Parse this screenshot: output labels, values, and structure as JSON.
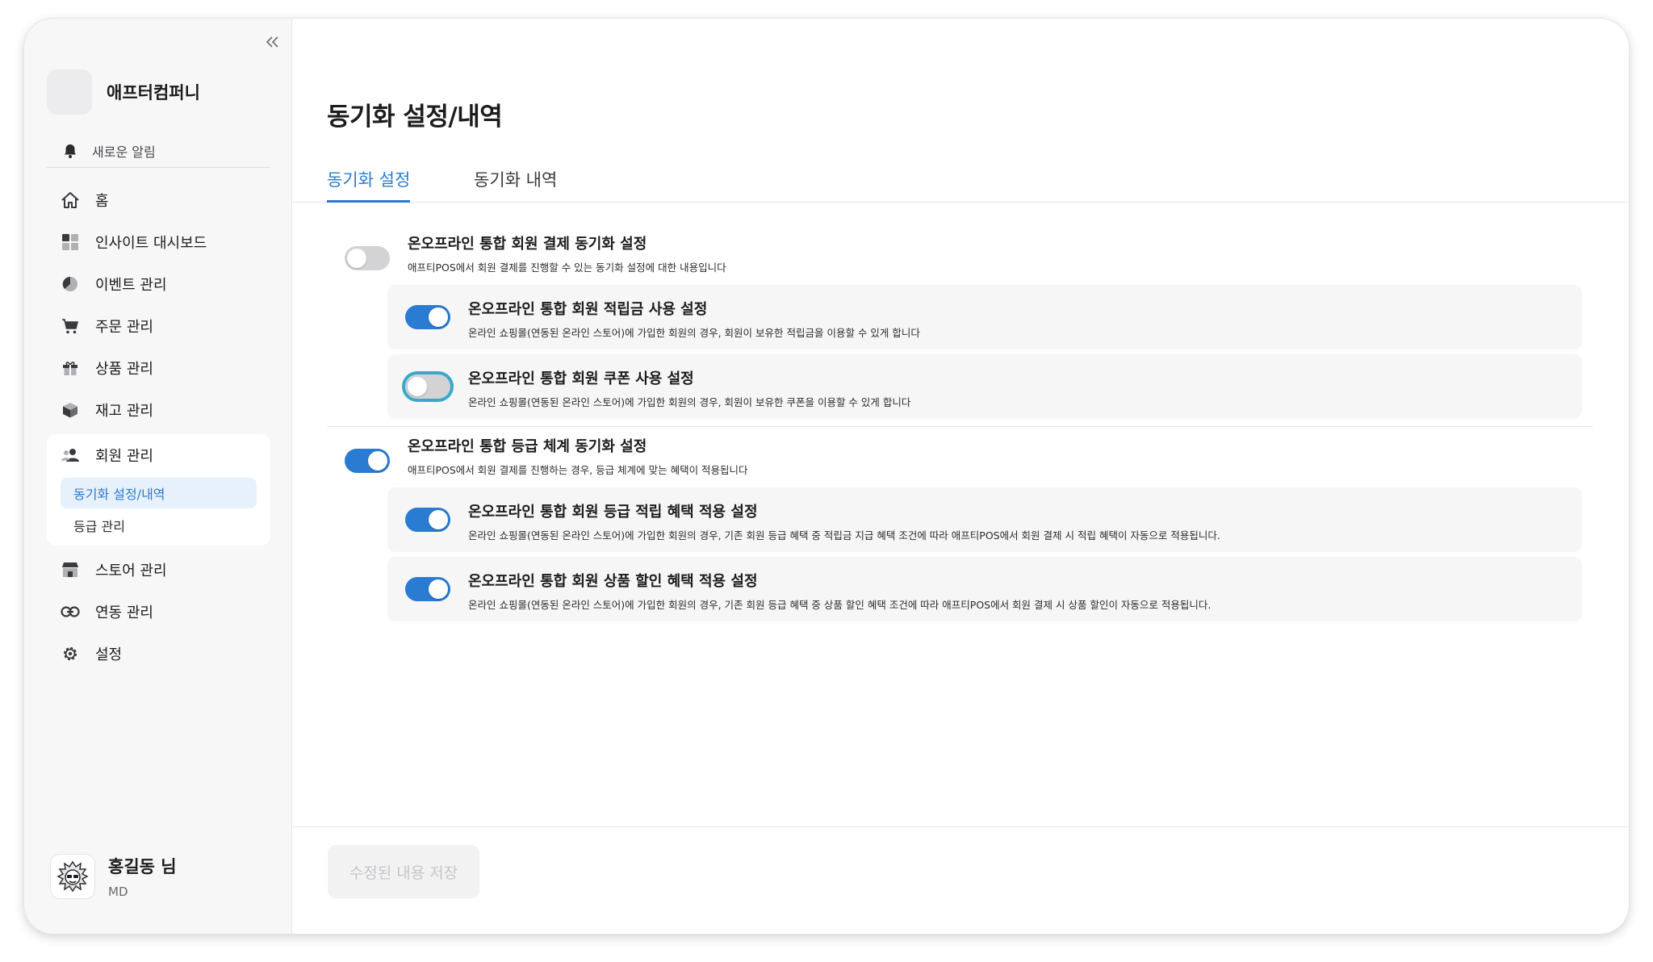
{
  "sidebar": {
    "company_name": "애프터컴퍼니",
    "notification_label": "새로운 알림",
    "items": [
      {
        "label": "홈",
        "icon": "home-icon"
      },
      {
        "label": "인사이트 대시보드",
        "icon": "dashboard-icon"
      },
      {
        "label": "이벤트 관리",
        "icon": "pie-chart-icon"
      },
      {
        "label": "주문 관리",
        "icon": "cart-icon"
      },
      {
        "label": "상품 관리",
        "icon": "gift-icon"
      },
      {
        "label": "재고 관리",
        "icon": "box-icon"
      },
      {
        "label": "회원 관리",
        "icon": "users-icon"
      },
      {
        "label": "스토어 관리",
        "icon": "store-icon"
      },
      {
        "label": "연동 관리",
        "icon": "link-icon"
      },
      {
        "label": "설정",
        "icon": "gear-icon"
      }
    ],
    "member_sub_items": [
      {
        "label": "동기화 설정/내역",
        "active": true
      },
      {
        "label": "등급 관리",
        "active": false
      }
    ],
    "user": {
      "name": "홍길동 님",
      "role": "MD"
    }
  },
  "main": {
    "title": "동기화 설정/내역",
    "tabs": [
      {
        "label": "동기화 설정",
        "active": true
      },
      {
        "label": "동기화 내역",
        "active": false
      }
    ],
    "sections": [
      {
        "title": "온오프라인 통합 회원 결제 동기화 설정",
        "desc": "애프티POS에서 회원 결제를 진행할 수 있는 동기화 설정에 대한 내용입니다",
        "enabled": false,
        "children": [
          {
            "title": "온오프라인 통합 회원 적립금 사용 설정",
            "desc": "온라인 쇼핑몰(연동된 온라인 스토어)에 가입한 회원의 경우, 회원이 보유한 적립금을 이용할 수 있게 합니다",
            "enabled": true
          },
          {
            "title": "온오프라인 통합 회원 쿠폰 사용 설정",
            "desc": "온라인 쇼핑몰(연동된 온라인 스토어)에 가입한 회원의 경우, 회원이 보유한 쿠폰을 이용할 수 있게 합니다",
            "enabled": false
          }
        ]
      },
      {
        "title": "온오프라인 통합 등급 체계 동기화 설정",
        "desc": "애프티POS에서 회원 결제를 진행하는 경우, 등급 체계에 맞는 혜택이 적용됩니다",
        "enabled": true,
        "children": [
          {
            "title": "온오프라인 통합 회원 등급 적립 혜택 적용 설정",
            "desc": "온라인 쇼핑몰(연동된 온라인 스토어)에 가입한 회원의 경우, 기존 회원 등급 혜택 중 적립금 지급 혜택 조건에 따라 애프티POS에서 회원 결제 시 적립 혜택이 자동으로 적용됩니다.",
            "enabled": true
          },
          {
            "title": "온오프라인 통합 회원 상품 할인 혜택 적용 설정",
            "desc": "온라인 쇼핑몰(연동된 온라인 스토어)에 가입한 회원의 경우, 기존 회원 등급 혜택 중 상품 할인 혜택 조건에 따라 애프티POS에서 회원 결제 시 상품 할인이 자동으로 적용됩니다.",
            "enabled": true
          }
        ]
      }
    ],
    "save_label": "수정된 내용 저장"
  },
  "colors": {
    "accent": "#2a7bd2",
    "toggle_off": "#d3d3d6",
    "focus_ring": "#3aa9c9"
  }
}
